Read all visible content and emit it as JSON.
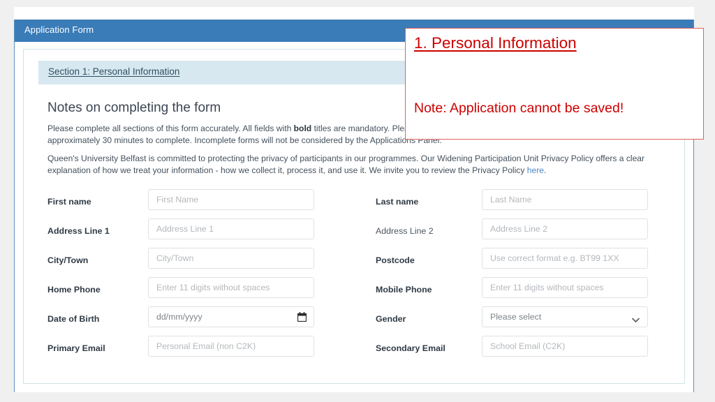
{
  "window": {
    "title": "Application Form"
  },
  "section": {
    "header_label": "Section 1: Personal Information"
  },
  "notes": {
    "heading": "Notes on completing the form",
    "para1_part1": "Please complete all sections of this form accurately. All fields with ",
    "para1_bold": "bold",
    "para1_part2": " titles are mandatory. Please note this form must be submitted in a single attempt. It will take approximately 30 minutes to complete. Incomplete forms will not be considered by the Applications Panel.",
    "para2_part1": "Queen's University Belfast is committed to protecting the privacy of participants in our programmes. Our Widening Participation Unit Privacy Policy offers a clear explanation of how we treat your information - how we collect it, process it, and use it. We invite you to review the Privacy Policy ",
    "para2_link": "here",
    "para2_part2": "."
  },
  "form": {
    "left_fields": [
      {
        "label": "First name",
        "placeholder": "First Name",
        "mandatory": true,
        "type": "text"
      },
      {
        "label": "Address Line 1",
        "placeholder": "Address Line 1",
        "mandatory": true,
        "type": "text"
      },
      {
        "label": "City/Town",
        "placeholder": "City/Town",
        "mandatory": true,
        "type": "text"
      },
      {
        "label": "Home Phone",
        "placeholder": "Enter 11 digits without spaces",
        "mandatory": true,
        "type": "text"
      },
      {
        "label": "Date of Birth",
        "placeholder": "dd/mm/yyyy",
        "mandatory": true,
        "type": "date",
        "icon": "calendar-icon"
      },
      {
        "label": "Primary Email",
        "placeholder": "Personal Email (non C2K)",
        "mandatory": true,
        "type": "email"
      }
    ],
    "right_fields": [
      {
        "label": "Last name",
        "placeholder": "Last Name",
        "mandatory": true,
        "type": "text"
      },
      {
        "label": "Address Line 2",
        "placeholder": "Address Line 2",
        "mandatory": false,
        "type": "text"
      },
      {
        "label": "Postcode",
        "placeholder": "Use correct format e.g. BT99 1XX",
        "mandatory": true,
        "type": "text"
      },
      {
        "label": "Mobile Phone",
        "placeholder": "Enter 11 digits without spaces",
        "mandatory": true,
        "type": "text"
      },
      {
        "label": "Gender",
        "placeholder": "Please select",
        "mandatory": true,
        "type": "select",
        "icon": "chevron-down-icon"
      },
      {
        "label": "Secondary Email",
        "placeholder": "School Email (C2K)",
        "mandatory": true,
        "type": "email"
      }
    ]
  },
  "annotation": {
    "title": "1. Personal Information",
    "note": "Note: Application cannot be saved!",
    "color": "#cc0000",
    "border_color": "#e0615f"
  },
  "colors": {
    "header_bar": "#3a7cb8",
    "section_strip": "#d7e8f1",
    "panel_border": "#cfe3e6",
    "link": "#4a86c4",
    "page_background": "#f0f0f0"
  }
}
